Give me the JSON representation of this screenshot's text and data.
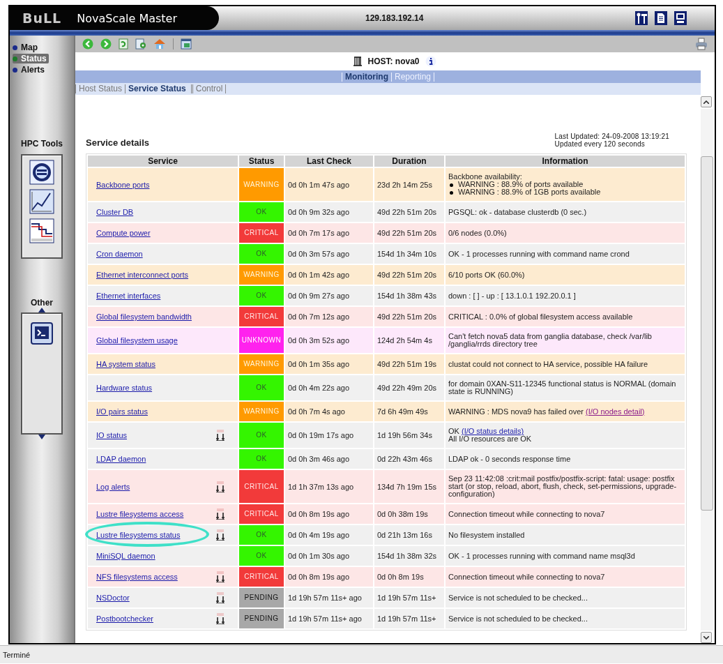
{
  "header": {
    "logo": "BuLL",
    "product": "NovaScale Master",
    "address": "129.183.192.14"
  },
  "sidebar": {
    "items": [
      {
        "label": "Map",
        "selected": false,
        "color": "#1a2a8a"
      },
      {
        "label": "Status",
        "selected": true,
        "color": "#1c7a2a"
      },
      {
        "label": "Alerts",
        "selected": false,
        "color": "#1a2a8a"
      }
    ],
    "sections": [
      {
        "title": "HPC Tools"
      },
      {
        "title": "Other"
      }
    ]
  },
  "host": {
    "label": "HOST: nova0"
  },
  "tabs": [
    {
      "label": "Monitoring",
      "selected": true
    },
    {
      "label": "Reporting",
      "selected": false
    }
  ],
  "subtabs": [
    {
      "label": "Host Status",
      "selected": false
    },
    {
      "label": "Service Status",
      "selected": true
    },
    {
      "label": "Control",
      "selected": false
    }
  ],
  "panel": {
    "title": "Service details",
    "last_updated": "Last Updated: 24-09-2008 13:19:21",
    "refresh": "Updated every 120 seconds"
  },
  "table": {
    "columns": [
      "Service",
      "Status",
      "Last Check",
      "Duration",
      "Information"
    ],
    "rows": [
      {
        "service": "Backbone ports",
        "easy": false,
        "highlighted": false,
        "status": {
          "text": "WARNING",
          "kind": "warning"
        },
        "last_check": "0d 0h 1m 47s ago",
        "duration": "23d 2h 14m 25s",
        "information": [
          {
            "kind": "text",
            "text": "Backbone availability:"
          },
          {
            "kind": "bullet",
            "text": "WARNING : 88.9% of ports available"
          },
          {
            "kind": "bullet",
            "text": "WARNING : 88.9% of 1GB ports available"
          }
        ]
      },
      {
        "service": "Cluster DB",
        "easy": false,
        "highlighted": false,
        "status": {
          "text": "OK",
          "kind": "ok"
        },
        "last_check": "0d 0h 9m 32s ago",
        "duration": "49d 22h 51m 20s",
        "information": [
          {
            "kind": "text",
            "text": "PGSQL: ok - database clusterdb (0 sec.)"
          }
        ]
      },
      {
        "service": "Compute power",
        "easy": false,
        "highlighted": false,
        "status": {
          "text": "CRITICAL",
          "kind": "critical"
        },
        "last_check": "0d 0h 7m 17s ago",
        "duration": "49d 22h 51m 20s",
        "information": [
          {
            "kind": "text",
            "text": "0/6 nodes (0.0%)"
          }
        ]
      },
      {
        "service": "Cron daemon",
        "easy": false,
        "highlighted": false,
        "status": {
          "text": "OK",
          "kind": "ok"
        },
        "last_check": "0d 0h 3m 57s ago",
        "duration": "154d 1h 34m 10s",
        "information": [
          {
            "kind": "text",
            "text": "OK - 1 processes running with command name crond"
          }
        ]
      },
      {
        "service": "Ethernet interconnect ports",
        "easy": false,
        "highlighted": false,
        "status": {
          "text": "WARNING",
          "kind": "warning"
        },
        "last_check": "0d 0h 1m 42s ago",
        "duration": "49d 22h 51m 20s",
        "information": [
          {
            "kind": "text",
            "text": "6/10 ports OK (60.0%)"
          }
        ]
      },
      {
        "service": "Ethernet interfaces",
        "easy": false,
        "highlighted": false,
        "status": {
          "text": "OK",
          "kind": "ok"
        },
        "last_check": "0d 0h 9m 27s ago",
        "duration": "154d 1h 38m 43s",
        "information": [
          {
            "kind": "text",
            "text": "down : [ ] - up : [ 13.1.0.1 192.20.0.1 ]"
          }
        ]
      },
      {
        "service": "Global filesystem bandwidth",
        "easy": false,
        "highlighted": false,
        "status": {
          "text": "CRITICAL",
          "kind": "critical"
        },
        "last_check": "0d 0h 7m 12s ago",
        "duration": "49d 22h 51m 20s",
        "information": [
          {
            "kind": "text",
            "text": "CRITICAL : 0.0% of global filesystem access available"
          }
        ]
      },
      {
        "service": "Global filesystem usage",
        "easy": false,
        "highlighted": false,
        "status": {
          "text": "UNKNOWN",
          "kind": "unknown"
        },
        "last_check": "0d 0h 3m 52s ago",
        "duration": "124d 2h 54m 4s",
        "information": [
          {
            "kind": "text",
            "text": "Can't fetch nova5 data from ganglia database, check /var/lib /ganglia/rrds directory tree"
          }
        ]
      },
      {
        "service": "HA system status",
        "easy": false,
        "highlighted": false,
        "status": {
          "text": "WARNING",
          "kind": "warning"
        },
        "last_check": "0d 0h 1m 35s ago",
        "duration": "49d 22h 51m 19s",
        "information": [
          {
            "kind": "text",
            "text": "clustat could not connect to HA service, possible HA failure"
          }
        ]
      },
      {
        "service": "Hardware status",
        "easy": false,
        "highlighted": false,
        "status": {
          "text": "OK",
          "kind": "ok"
        },
        "last_check": "0d 0h 4m 22s ago",
        "duration": "49d 22h 49m 20s",
        "information": [
          {
            "kind": "text",
            "text": "for domain 0XAN-S11-12345 functional status is NORMAL (domain state is RUNNING)"
          }
        ]
      },
      {
        "service": "I/O pairs status",
        "easy": false,
        "highlighted": false,
        "status": {
          "text": "WARNING",
          "kind": "warning"
        },
        "last_check": "0d 0h 7m 4s ago",
        "duration": "7d 6h 49m 49s",
        "information": [
          {
            "kind": "text",
            "text": "WARNING : MDS nova9 has failed over",
            "link": "(I/O nodes detail)",
            "visited": true
          }
        ]
      },
      {
        "service": "IO status",
        "easy": true,
        "highlighted": false,
        "status": {
          "text": "OK",
          "kind": "ok"
        },
        "last_check": "0d 0h 19m 17s ago",
        "duration": "1d 19h 56m 34s",
        "information": [
          {
            "kind": "text",
            "text": "OK",
            "link": "(I/O status details)",
            "visited": false
          },
          {
            "kind": "text",
            "text": "All I/O resources are OK"
          }
        ]
      },
      {
        "service": "LDAP daemon",
        "easy": false,
        "highlighted": false,
        "status": {
          "text": "OK",
          "kind": "ok"
        },
        "last_check": "0d 0h 3m 46s ago",
        "duration": "0d 22h 43m 46s",
        "information": [
          {
            "kind": "text",
            "text": "LDAP ok - 0 seconds response time"
          }
        ]
      },
      {
        "service": "Log alerts",
        "easy": true,
        "highlighted": false,
        "status": {
          "text": "CRITICAL",
          "kind": "critical"
        },
        "last_check": "1d 1h 37m 13s ago",
        "duration": "134d 7h 19m 15s",
        "information": [
          {
            "kind": "text",
            "text": "Sep 23 11:42:08 :crit:mail postfix/postfix-script: fatal: usage: postfix start (or stop, reload, abort, flush, check, set-permissions, upgrade-configuration)"
          }
        ]
      },
      {
        "service": "Lustre filesystems access",
        "easy": true,
        "highlighted": false,
        "status": {
          "text": "CRITICAL",
          "kind": "critical"
        },
        "last_check": "0d 0h 8m 19s ago",
        "duration": "0d 0h 38m 19s",
        "information": [
          {
            "kind": "text",
            "text": "Connection timeout while connecting to nova7"
          }
        ]
      },
      {
        "service": "Lustre filesystems status",
        "easy": true,
        "highlighted": true,
        "status": {
          "text": "OK",
          "kind": "ok"
        },
        "last_check": "0d 0h 4m 19s ago",
        "duration": "0d 21h 13m 16s",
        "information": [
          {
            "kind": "text",
            "text": "No filesystem installed"
          }
        ]
      },
      {
        "service": "MiniSQL daemon",
        "easy": false,
        "highlighted": false,
        "status": {
          "text": "OK",
          "kind": "ok"
        },
        "last_check": "0d 0h 1m 30s ago",
        "duration": "154d 1h 38m 32s",
        "information": [
          {
            "kind": "text",
            "text": "OK - 1 processes running with command name msql3d"
          }
        ]
      },
      {
        "service": "NFS filesystems access",
        "easy": true,
        "highlighted": false,
        "status": {
          "text": "CRITICAL",
          "kind": "critical"
        },
        "last_check": "0d 0h 8m 19s ago",
        "duration": "0d 0h 8m 19s",
        "information": [
          {
            "kind": "text",
            "text": "Connection timeout while connecting to nova7"
          }
        ]
      },
      {
        "service": "NSDoctor",
        "easy": true,
        "highlighted": false,
        "status": {
          "text": "PENDING",
          "kind": "pending"
        },
        "last_check": "1d 19h 57m 11s+ ago",
        "duration": "1d 19h 57m 11s+",
        "information": [
          {
            "kind": "text",
            "text": "Service is not scheduled to be checked..."
          }
        ]
      },
      {
        "service": "Postbootchecker",
        "easy": true,
        "highlighted": false,
        "status": {
          "text": "PENDING",
          "kind": "pending"
        },
        "last_check": "1d 19h 57m 11s+ ago",
        "duration": "1d 19h 57m 11s+",
        "information": [
          {
            "kind": "text",
            "text": "Service is not scheduled to be checked..."
          }
        ]
      }
    ]
  },
  "status_bar": {
    "text": "Terminé"
  }
}
